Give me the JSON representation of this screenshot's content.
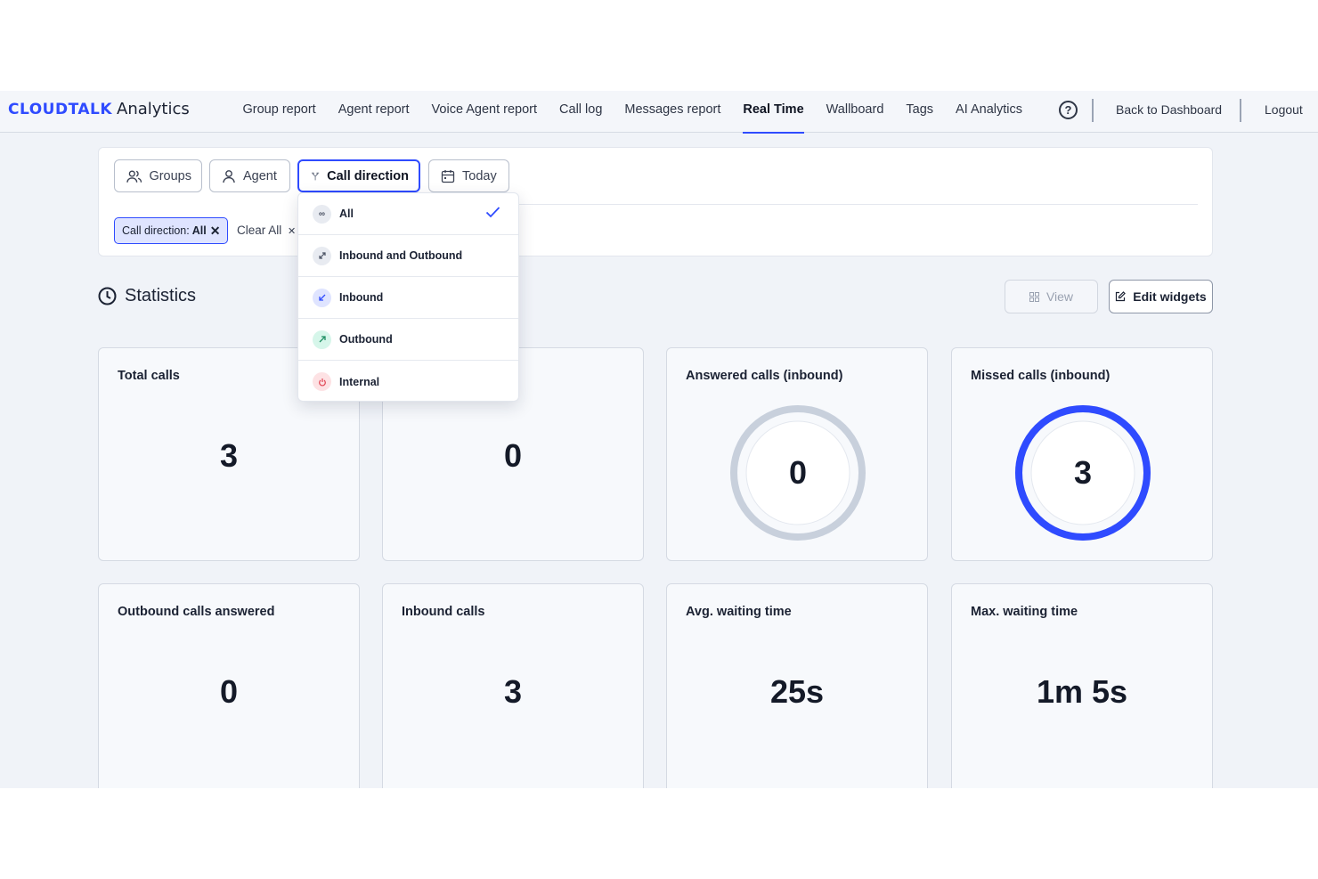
{
  "header": {
    "logo_brand": "CLOUDTALK",
    "logo_product": "Analytics",
    "nav": [
      {
        "label": "Group report",
        "active": false
      },
      {
        "label": "Agent report",
        "active": false
      },
      {
        "label": "Voice Agent report",
        "active": false
      },
      {
        "label": "Call log",
        "active": false
      },
      {
        "label": "Messages report",
        "active": false
      },
      {
        "label": "Real Time",
        "active": true
      },
      {
        "label": "Wallboard",
        "active": false
      },
      {
        "label": "Tags",
        "active": false
      },
      {
        "label": "AI Analytics",
        "active": false
      }
    ],
    "help_icon": "question-circle-icon",
    "back_link": "Back to Dashboard",
    "logout": "Logout",
    "accent_color": "#2f4bff"
  },
  "filters": {
    "groups_label": "Groups",
    "agent_label": "Agent",
    "call_direction_label": "Call direction",
    "date_label": "Today",
    "chip_prefix": "Call direction:",
    "chip_value": "All",
    "clear_all": "Clear All"
  },
  "dropdown": {
    "items": [
      {
        "label": "All",
        "icon": "infinity-icon",
        "selected": true
      },
      {
        "label": "Inbound and Outbound",
        "icon": "arrows-diagonal-icon",
        "selected": false
      },
      {
        "label": "Inbound",
        "icon": "arrow-down-left-icon",
        "selected": false
      },
      {
        "label": "Outbound",
        "icon": "arrow-up-right-icon",
        "selected": false
      },
      {
        "label": "Internal",
        "icon": "power-icon",
        "selected": false
      }
    ]
  },
  "statistics": {
    "title": "Statistics",
    "view_label": "View",
    "edit_label": "Edit widgets"
  },
  "widgets": [
    {
      "title": "Total calls",
      "value": "3"
    },
    {
      "title": "",
      "value": "0"
    },
    {
      "title": "Answered calls (inbound)",
      "value": "0",
      "ring_fill": 0,
      "ring_color": "#c8d0dc"
    },
    {
      "title": "Missed calls (inbound)",
      "value": "3",
      "ring_fill": 1,
      "ring_color": "#2f4bff"
    },
    {
      "title": "Outbound calls answered",
      "value": "0"
    },
    {
      "title": "Inbound calls",
      "value": "3"
    },
    {
      "title": "Avg. waiting time",
      "value": "25s"
    },
    {
      "title": "Max. waiting time",
      "value": "1m 5s"
    }
  ]
}
